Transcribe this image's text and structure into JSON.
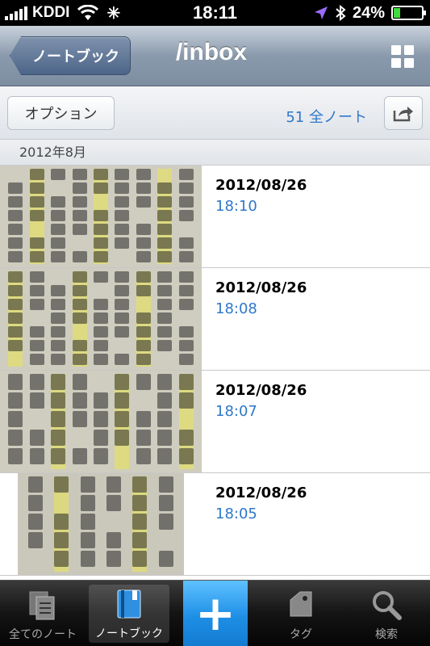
{
  "status": {
    "carrier": "KDDI",
    "time": "18:11",
    "battery": "24%",
    "battery_level": 0.24,
    "colors": {
      "battery": "#3fdc3a",
      "location": "#9b6bff"
    }
  },
  "nav": {
    "back_label": "ノートブック",
    "title": "/inbox",
    "grid_icon": "grid-view-icon"
  },
  "toolbar": {
    "options_label": "オプション",
    "note_count": "51 全ノート",
    "share_icon": "share-icon"
  },
  "section": {
    "header": "2012年8月"
  },
  "notes": [
    {
      "date": "2012/08/26",
      "time": "18:10"
    },
    {
      "date": "2012/08/26",
      "time": "18:08"
    },
    {
      "date": "2012/08/26",
      "time": "18:07"
    },
    {
      "date": "2012/08/26",
      "time": "18:05"
    }
  ],
  "tabs": [
    {
      "label": "全てのノート",
      "icon": "all-notes-icon"
    },
    {
      "label": "ノートブック",
      "icon": "notebook-icon"
    },
    {
      "label": "",
      "icon": "add-note-icon"
    },
    {
      "label": "タグ",
      "icon": "tag-icon"
    },
    {
      "label": "検索",
      "icon": "search-icon"
    }
  ],
  "colors": {
    "accent": "#2f78c8",
    "add_button": "#1e8fe6"
  }
}
